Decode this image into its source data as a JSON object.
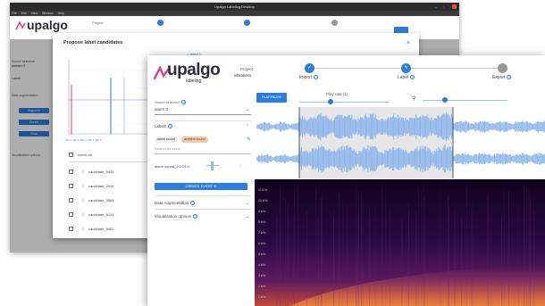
{
  "back_window": {
    "title": "Upalgo Labeling Desktop",
    "menu": [
      "File",
      "Edit",
      "View",
      "Window",
      "Help"
    ],
    "logo": "upalgo",
    "header_tabs": [
      "Project",
      "",
      "",
      ""
    ],
    "sidebar_labels": [
      "Source selection",
      "ambient 2",
      "Labels",
      "Data augmentation",
      "Visualization options"
    ],
    "buttons": [
      "Augment",
      "Create",
      "Clear"
    ]
  },
  "modal": {
    "title": "Propose label candidates",
    "legend_label": "select 1",
    "check_all": "check all",
    "candidates": [
      "candidate_6448",
      "candidate_2518",
      "candidate_3563",
      "candidate_8121",
      "candidate_8402"
    ],
    "chart_tabs": [
      "Tab 1",
      "Tab 2",
      "Tab 3",
      "Tab 4",
      "Tab 5"
    ]
  },
  "front_window": {
    "logo": "upalgo",
    "logo_sub": "labeling",
    "project_label": "Project",
    "project_value": "vibrations",
    "steps": [
      {
        "label": "Import",
        "state": "done"
      },
      {
        "label": "Label",
        "state": "active"
      },
      {
        "label": "Export",
        "state": "pending"
      }
    ],
    "sidebar": {
      "source_label": "Sound selection",
      "source_value": "alarm 3",
      "labels_title": "Labels",
      "chips": [
        "alarm sound",
        "ambient sound"
      ],
      "search_placeholder": "Search an event",
      "event_item": "alarm sound_2:0:25.8",
      "create_button": "CREATE EVENT",
      "augmentation": "Data Augmentation",
      "visualization": "Visualization options"
    },
    "play_button": "PLAY/PAUSE",
    "play_rate_label": "Play rate (1)",
    "freq_labels": [
      "11 kHz",
      "10 kHz",
      "9 kHz",
      "8 kHz",
      "7 kHz",
      "6 kHz",
      "5 kHz",
      "4 kHz",
      "3 kHz",
      "2 kHz",
      "1 kHz"
    ],
    "colors": {
      "accent": "#2b7de0",
      "wave": "#8fb8ec",
      "spec_bg": "#10021b"
    }
  }
}
